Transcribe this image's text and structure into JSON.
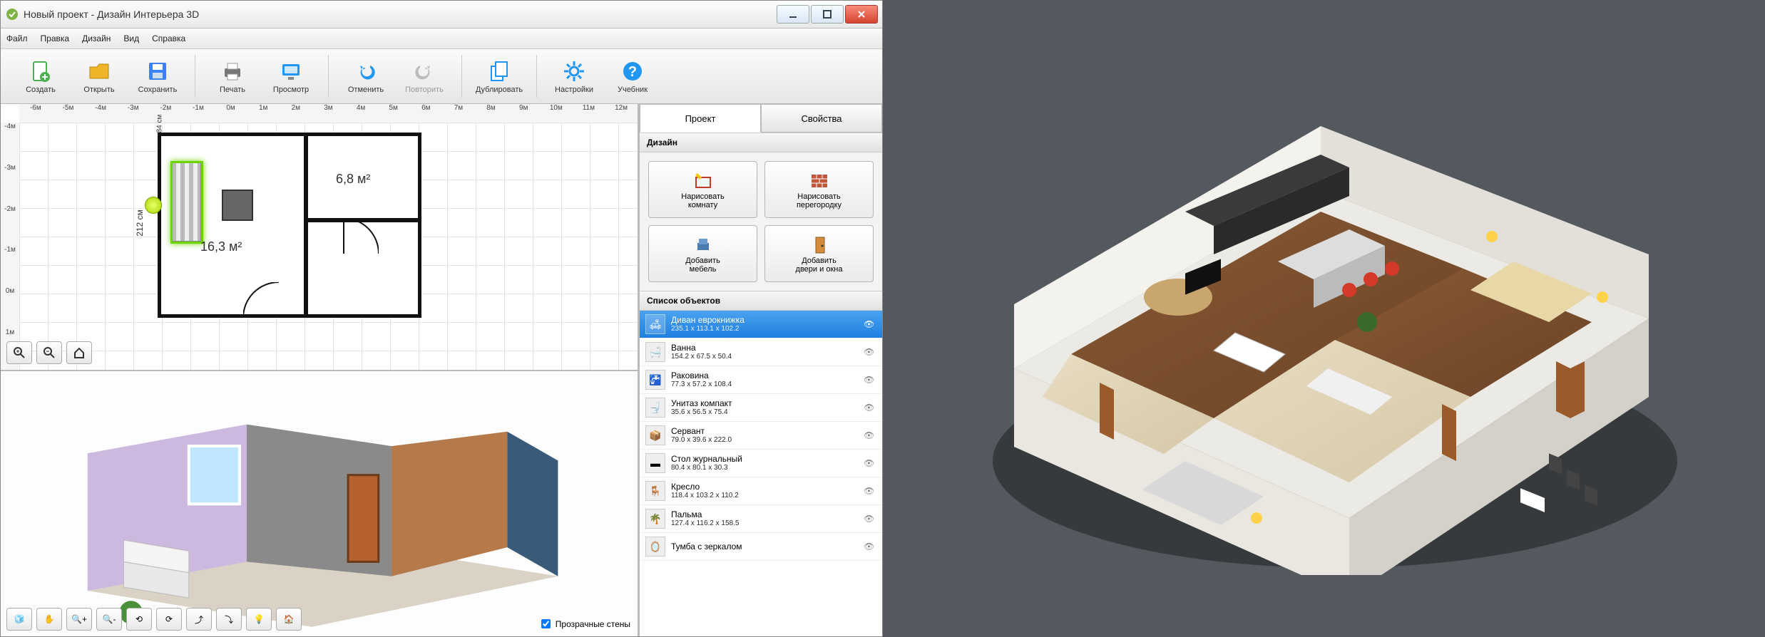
{
  "window": {
    "title": "Новый проект - Дизайн Интерьера 3D"
  },
  "menu": [
    "Файл",
    "Правка",
    "Дизайн",
    "Вид",
    "Справка"
  ],
  "toolbar": {
    "groups": [
      [
        {
          "id": "new",
          "label": "Создать",
          "icon": "file-plus",
          "color": "#4caf50"
        },
        {
          "id": "open",
          "label": "Открыть",
          "icon": "folder-open",
          "color": "#f0b429"
        },
        {
          "id": "save",
          "label": "Сохранить",
          "icon": "floppy",
          "color": "#3b82f6"
        }
      ],
      [
        {
          "id": "print",
          "label": "Печать",
          "icon": "printer",
          "color": "#777"
        },
        {
          "id": "preview",
          "label": "Просмотр",
          "icon": "monitor",
          "color": "#2196f3"
        }
      ],
      [
        {
          "id": "undo",
          "label": "Отменить",
          "icon": "undo",
          "color": "#2196f3"
        },
        {
          "id": "redo",
          "label": "Повторить",
          "icon": "redo",
          "color": "#bbb",
          "disabled": true
        }
      ],
      [
        {
          "id": "dup",
          "label": "Дублировать",
          "icon": "duplicate",
          "color": "#2196f3"
        }
      ],
      [
        {
          "id": "settings",
          "label": "Настройки",
          "icon": "gear",
          "color": "#2196f3"
        },
        {
          "id": "help",
          "label": "Учебник",
          "icon": "help",
          "color": "#2196f3"
        }
      ]
    ]
  },
  "ruler_h": [
    "-6м",
    "-5м",
    "-4м",
    "-3м",
    "-2м",
    "-1м",
    "0м",
    "1м",
    "2м",
    "3м",
    "4м",
    "5м",
    "6м",
    "7м",
    "8м",
    "9м",
    "10м",
    "11м",
    "12м"
  ],
  "ruler_v": [
    "-4м",
    "-3м",
    "-2м",
    "-1м",
    "0м",
    "1м"
  ],
  "plan": {
    "room1_area": "16,3 м²",
    "room2_area": "6,8 м²",
    "dim_left": "212 см",
    "dim_top": "84 см"
  },
  "tabs": {
    "project": "Проект",
    "props": "Свойства"
  },
  "design": {
    "header": "Дизайн",
    "buttons": [
      {
        "id": "draw-room",
        "label": "Нарисовать\nкомнату",
        "icon": "pencil-room"
      },
      {
        "id": "draw-wall",
        "label": "Нарисовать\nперегородку",
        "icon": "brick-wall"
      },
      {
        "id": "add-furn",
        "label": "Добавить\nмебель",
        "icon": "armchair"
      },
      {
        "id": "add-door",
        "label": "Добавить\nдвери и окна",
        "icon": "door"
      }
    ]
  },
  "objects": {
    "header": "Список объектов",
    "items": [
      {
        "name": "Диван еврокнижка",
        "dims": "235.1 x 113.1 x 102.2",
        "icon": "🛋",
        "selected": true
      },
      {
        "name": "Ванна",
        "dims": "154.2 x 67.5 x 50.4",
        "icon": "🛁"
      },
      {
        "name": "Раковина",
        "dims": "77.3 x 57.2 x 108.4",
        "icon": "🚰"
      },
      {
        "name": "Унитаз компакт",
        "dims": "35.6 x 56.5 x 75.4",
        "icon": "🚽"
      },
      {
        "name": "Сервант",
        "dims": "79.0 x 39.6 x 222.0",
        "icon": "📦"
      },
      {
        "name": "Стол журнальный",
        "dims": "80.4 x 80.1 x 30.3",
        "icon": "▬"
      },
      {
        "name": "Кресло",
        "dims": "118.4 x 103.2 x 110.2",
        "icon": "🪑"
      },
      {
        "name": "Пальма",
        "dims": "127.4 x 116.2 x 158.5",
        "icon": "🌴"
      },
      {
        "name": "Тумба с зеркалом",
        "dims": "",
        "icon": "🪞"
      }
    ]
  },
  "checkbox": {
    "transparent_walls": "Прозрачные стены"
  }
}
